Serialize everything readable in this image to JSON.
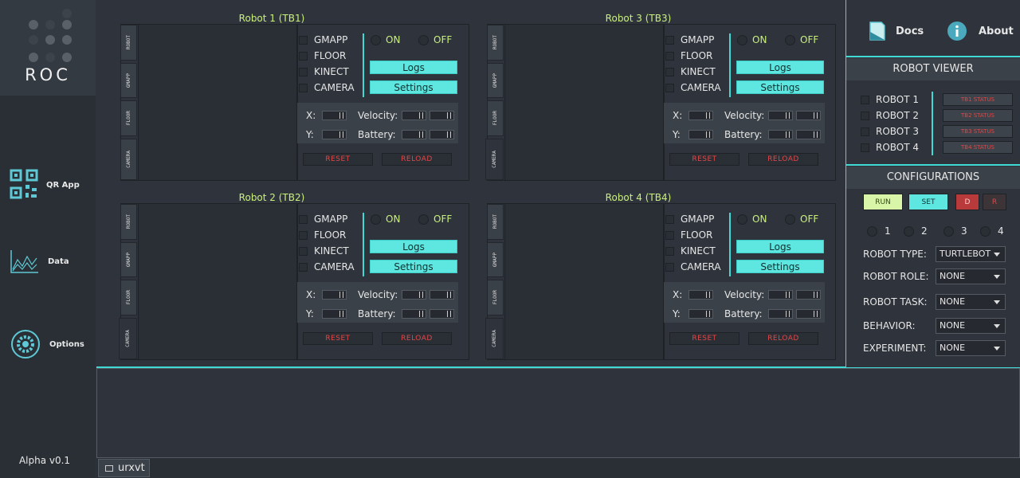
{
  "app": {
    "logo_text": "ROC",
    "version": "Alpha v0.1"
  },
  "sidebar": {
    "items": [
      {
        "label": "QR App",
        "icon": "qr-code-icon"
      },
      {
        "label": "Data",
        "icon": "chart-icon"
      },
      {
        "label": "Options",
        "icon": "gear-icon"
      }
    ]
  },
  "robots": [
    {
      "title": "Robot 1  (TB1)"
    },
    {
      "title": "Robot 3  (TB3)"
    },
    {
      "title": "Robot 2  (TB2)"
    },
    {
      "title": "Robot 4  (TB4)"
    }
  ],
  "robot_panel": {
    "tabs": [
      "ROBOT",
      "GMAPP",
      "FLOOR",
      "CAMERA"
    ],
    "checks": [
      "GMAPP",
      "FLOOR",
      "KINECT",
      "CAMERA"
    ],
    "on_label": "ON",
    "off_label": "OFF",
    "logs_label": "Logs",
    "settings_label": "Settings",
    "x_label": "X:",
    "y_label": "Y:",
    "velocity_label": "Velocity:",
    "battery_label": "Battery:",
    "reset_label": "RESET",
    "reload_label": "RELOAD"
  },
  "header": {
    "docs_label": "Docs",
    "about_label": "About"
  },
  "robot_viewer": {
    "title": "ROBOT VIEWER",
    "rows": [
      {
        "label": "ROBOT 1",
        "status": "TB1 STATUS"
      },
      {
        "label": "ROBOT 2",
        "status": "TB2 STATUS"
      },
      {
        "label": "ROBOT 3",
        "status": "TB3 STATUS"
      },
      {
        "label": "ROBOT 4",
        "status": "TB4 STATUS"
      }
    ]
  },
  "configurations": {
    "title": "CONFIGURATIONS",
    "run_label": "RUN",
    "set_label": "SET",
    "d_label": "D",
    "r_label": "R",
    "radios": [
      "1",
      "2",
      "3",
      "4"
    ],
    "fields": [
      {
        "label": "ROBOT TYPE:",
        "value": "TURTLEBOT"
      },
      {
        "label": "ROBOT ROLE:",
        "value": "NONE"
      },
      {
        "label": "ROBOT TASK:",
        "value": "NONE"
      },
      {
        "label": "BEHAVIOR:",
        "value": "NONE"
      },
      {
        "label": "EXPERIMENT:",
        "value": "NONE"
      }
    ]
  },
  "taskbar": {
    "item_label": "urxvt"
  },
  "colors": {
    "accent": "#40d9d3",
    "title_green": "#c9f07a",
    "button_cyan": "#5ee6e0",
    "status_red": "#d84a4a"
  }
}
